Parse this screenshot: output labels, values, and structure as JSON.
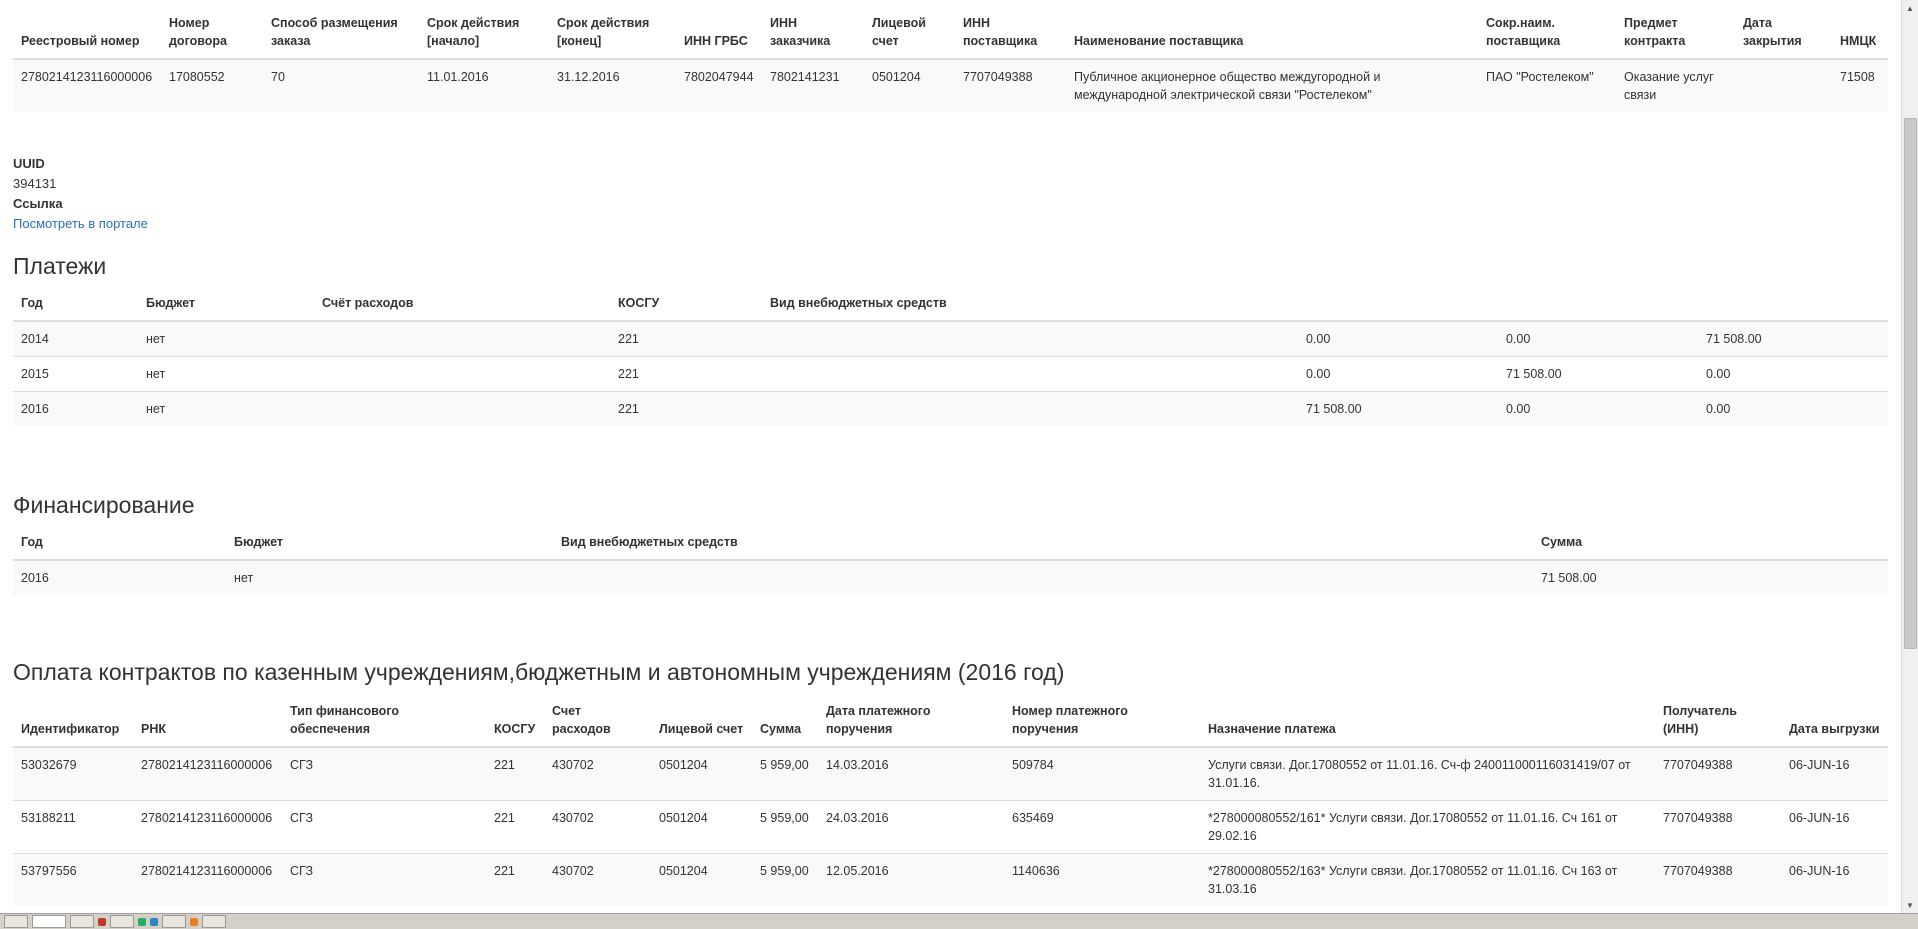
{
  "contract_table": {
    "headers": [
      "Реестровый номер",
      "Номер договора",
      "Способ размещения заказа",
      "Срок действия [начало]",
      "Срок действия [конец]",
      "ИНН ГРБС",
      "ИНН заказчика",
      "Лицевой счет",
      "ИНН поставщика",
      "Наименование поставщика",
      "Сокр.наим. поставщика",
      "Предмет контракта",
      "Дата закрытия",
      "НМЦК"
    ],
    "rows": [
      [
        "2780214123116000006",
        "17080552",
        "70",
        "11.01.2016",
        "31.12.2016",
        "7802047944",
        "7802141231",
        "0501204",
        "7707049388",
        "Публичное акционерное общество междугородной и международной электрической связи \"Ростелеком\"",
        "ПАО \"Ростелеком\"",
        "Оказание услуг связи",
        "",
        "71508"
      ]
    ]
  },
  "info": {
    "uuid_label": "UUID",
    "uuid_value": "394131",
    "link_label": "Ссылка",
    "link_text": "Посмотреть в портале"
  },
  "payments": {
    "title": "Платежи",
    "headers": [
      "Год",
      "Бюджет",
      "Счёт расходов",
      "КОСГУ",
      "Вид внебюджетных средств",
      "",
      "",
      ""
    ],
    "rows": [
      [
        "2014",
        "нет",
        "",
        "221",
        "",
        "0.00",
        "0.00",
        "71 508.00"
      ],
      [
        "2015",
        "нет",
        "",
        "221",
        "",
        "0.00",
        "71 508.00",
        "0.00"
      ],
      [
        "2016",
        "нет",
        "",
        "221",
        "",
        "71 508.00",
        "0.00",
        "0.00"
      ]
    ]
  },
  "financing": {
    "title": "Финансирование",
    "headers": [
      "Год",
      "Бюджет",
      "Вид внебюджетных средств",
      "Сумма"
    ],
    "rows": [
      [
        "2016",
        "нет",
        "",
        "71 508.00"
      ]
    ]
  },
  "contract_payments": {
    "title": "Оплата контрактов по казенным учреждениям,бюджетным и автономным учреждениям (2016 год)",
    "headers": [
      "Идентификатор",
      "РНК",
      "Тип финансового обеспечения",
      "КОСГУ",
      "Счет расходов",
      "Лицевой счет",
      "Сумма",
      "Дата платежного поручения",
      "Номер платежного поручения",
      "Назначение платежа",
      "Получатель (ИНН)",
      "Дата выгрузки"
    ],
    "rows": [
      [
        "53032679",
        "2780214123116000006",
        "СГЗ",
        "221",
        "430702",
        "0501204",
        "5 959,00",
        "14.03.2016",
        "509784",
        "Услуги связи. Дог.17080552 от 11.01.16. Сч-ф 240011000116031419/07 от 31.01.16.",
        "7707049388",
        "06-JUN-16"
      ],
      [
        "53188211",
        "2780214123116000006",
        "СГЗ",
        "221",
        "430702",
        "0501204",
        "5 959,00",
        "24.03.2016",
        "635469",
        "*278000080552/161* Услуги связи. Дог.17080552 от 11.01.16. Сч 161 от 29.02.16",
        "7707049388",
        "06-JUN-16"
      ],
      [
        "53797556",
        "2780214123116000006",
        "СГЗ",
        "221",
        "430702",
        "0501204",
        "5 959,00",
        "12.05.2016",
        "1140636",
        "*278000080552/163* Услуги связи. Дог.17080552 от 11.01.16. Сч 163 от 31.03.16",
        "7707049388",
        "06-JUN-16"
      ]
    ]
  },
  "scrollbar": {
    "position_fraction": 0.29,
    "visible_fraction": 0.6
  },
  "icons": {
    "scroll_up": "scroll-up-arrow-icon",
    "scroll_down": "scroll-down-arrow-icon"
  }
}
